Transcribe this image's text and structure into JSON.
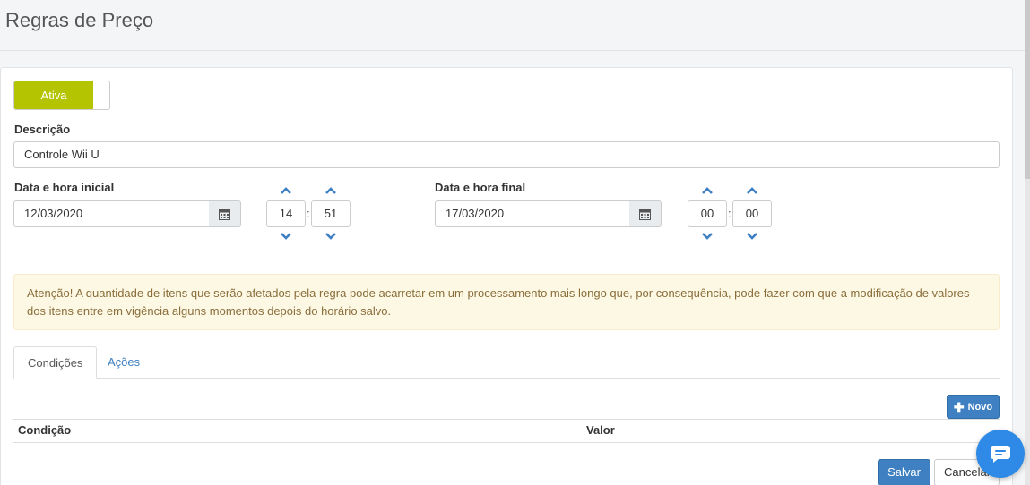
{
  "page": {
    "title": "Regras de Preço"
  },
  "toggle": {
    "label": "Ativa"
  },
  "description": {
    "label": "Descrição",
    "value": "Controle Wii U"
  },
  "start": {
    "label": "Data e hora inicial",
    "date": "12/03/2020",
    "hour": "14",
    "minute": "51"
  },
  "end": {
    "label": "Data e hora final",
    "date": "17/03/2020",
    "hour": "00",
    "minute": "00"
  },
  "time_separator": ":",
  "alert": {
    "text": "Atenção! A quantidade de itens que serão afetados pela regra pode acarretar em um processamento mais longo que, por consequência, pode fazer com que a modificação de valores dos itens entre em vigência alguns momentos depois do horário salvo."
  },
  "tabs": [
    {
      "label": "Condições"
    },
    {
      "label": "Ações"
    }
  ],
  "actions": {
    "new_label": "Novo",
    "save_label": "Salvar",
    "cancel_label": "Cancelar"
  },
  "table": {
    "columns": [
      "Condição",
      "Valor"
    ]
  },
  "icons": {
    "calendar": "calendar-icon",
    "up": "chevron-up-icon",
    "down": "chevron-down-icon",
    "plus": "plus-icon",
    "chat": "chat-icon"
  },
  "colors": {
    "toggle_on": "#b5c400",
    "primary": "#3f80c3",
    "link": "#3f7fbf",
    "alert_bg": "#fcf8e3",
    "alert_text": "#8a6d3b",
    "chat": "#2e8ae6"
  }
}
